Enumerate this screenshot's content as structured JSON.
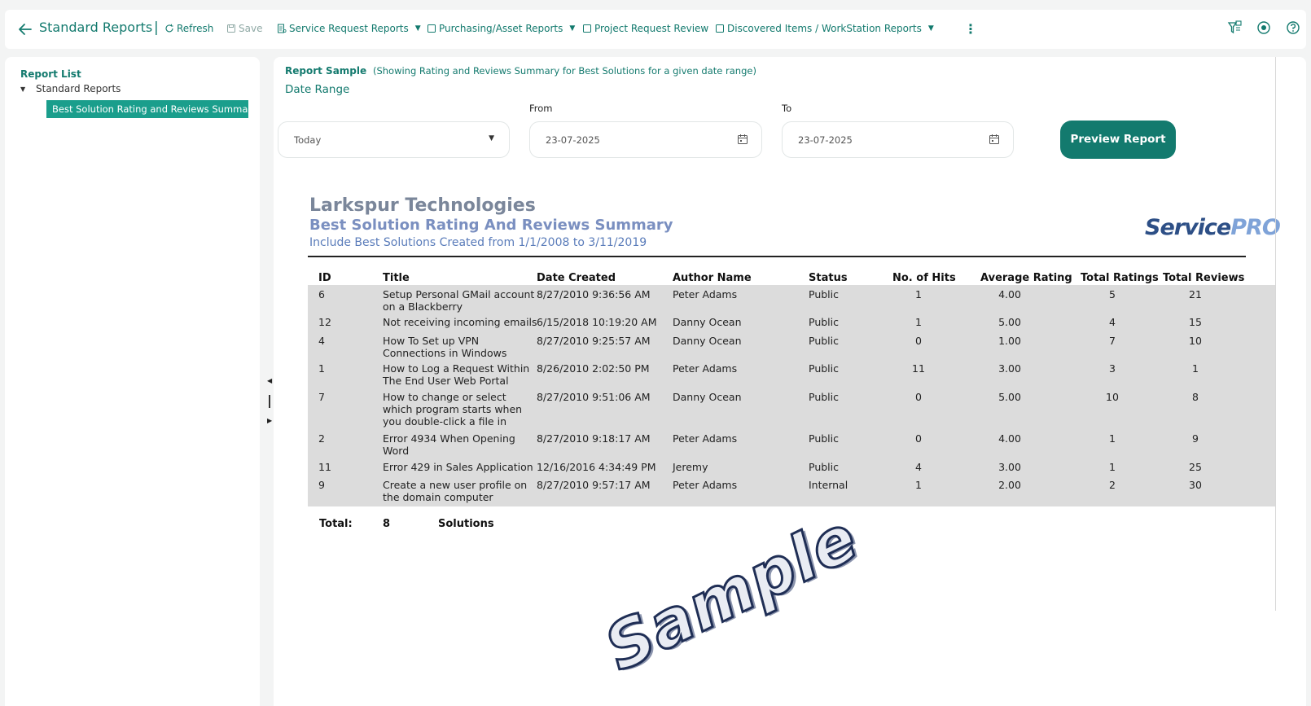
{
  "topbar": {
    "title": "Standard Reports",
    "separator": "|",
    "refresh": "Refresh",
    "save": "Save",
    "service_request_reports": "Service Request Reports",
    "purchasing_asset_reports": "Purchasing/Asset Reports",
    "project_request_review": "Project Request Review",
    "discovered_items": "Discovered Items / WorkStation Reports",
    "icons": [
      "back-arrow-icon",
      "refresh-icon",
      "save-icon",
      "report-icon",
      "filter-icon",
      "record-icon",
      "help-icon"
    ]
  },
  "sidebar": {
    "title": "Report List",
    "node": "Standard Reports",
    "selected_leaf": "Best Solution Rating and Reviews Summary"
  },
  "main": {
    "report_sample_label": "Report Sample",
    "report_sample_desc": "(Showing Rating and Reviews Summary for Best Solutions for a given date range)",
    "date_range_label": "Date Range",
    "range_value": "Today",
    "from_label": "From",
    "from_value": "23-07-2025",
    "to_label": "To",
    "to_value": "23-07-2025",
    "preview_button": "Preview Report"
  },
  "report": {
    "company": "Larkspur Technologies",
    "title": "Best Solution Rating And Reviews Summary",
    "subtitle": "Include Best Solutions Created from 1/1/2008 to 3/11/2019",
    "logo_part1": "Service",
    "logo_part2": "PRO",
    "columns": [
      "ID",
      "Title",
      "Date Created",
      "Author Name",
      "Status",
      "No. of Hits",
      "Average Rating",
      "Total Ratings",
      "Total Reviews"
    ],
    "rows": [
      {
        "id": "6",
        "title": "Setup Personal GMail account\non a Blackberry",
        "date": "8/27/2010 9:36:56 AM",
        "author": "Peter Adams",
        "status": "Public",
        "hits": "1",
        "avg": "4.00",
        "ratings": "5",
        "reviews": "21"
      },
      {
        "id": "12",
        "title": "Not receiving incoming emails",
        "date": "6/15/2018 10:19:20 AM",
        "author": "Danny Ocean",
        "status": "Public",
        "hits": "1",
        "avg": "5.00",
        "ratings": "4",
        "reviews": "15"
      },
      {
        "id": "4",
        "title": "How To Set up VPN\nConnections in Windows",
        "date": "8/27/2010 9:25:57 AM",
        "author": "Danny Ocean",
        "status": "Public",
        "hits": "0",
        "avg": "1.00",
        "ratings": "7",
        "reviews": "10"
      },
      {
        "id": "1",
        "title": "How to Log a Request Within\nThe End User Web Portal",
        "date": "8/26/2010 2:02:50 PM",
        "author": "Peter Adams",
        "status": "Public",
        "hits": "11",
        "avg": "3.00",
        "ratings": "3",
        "reviews": "1"
      },
      {
        "id": "7",
        "title": "How to change or select\nwhich program starts when\nyou double-click a file in",
        "date": "8/27/2010 9:51:06 AM",
        "author": "Danny Ocean",
        "status": "Public",
        "hits": "0",
        "avg": "5.00",
        "ratings": "10",
        "reviews": "8"
      },
      {
        "id": "2",
        "title": "Error 4934 When Opening\nWord",
        "date": "8/27/2010 9:18:17 AM",
        "author": "Peter Adams",
        "status": "Public",
        "hits": "0",
        "avg": "4.00",
        "ratings": "1",
        "reviews": "9"
      },
      {
        "id": "11",
        "title": "Error 429 in Sales Application",
        "date": "12/16/2016 4:34:49 PM",
        "author": "Jeremy",
        "status": "Public",
        "hits": "4",
        "avg": "3.00",
        "ratings": "1",
        "reviews": "25"
      },
      {
        "id": "9",
        "title": "Create a new user profile on\nthe domain computer",
        "date": "8/27/2010 9:57:17 AM",
        "author": "Peter Adams",
        "status": "Internal",
        "hits": "1",
        "avg": "2.00",
        "ratings": "2",
        "reviews": "30"
      }
    ],
    "total_label": "Total:",
    "total_count": "8",
    "total_unit": "Solutions",
    "watermark": "Sample"
  },
  "colors": {
    "brand": "#137a6e",
    "selected": "#1a9e8c"
  }
}
